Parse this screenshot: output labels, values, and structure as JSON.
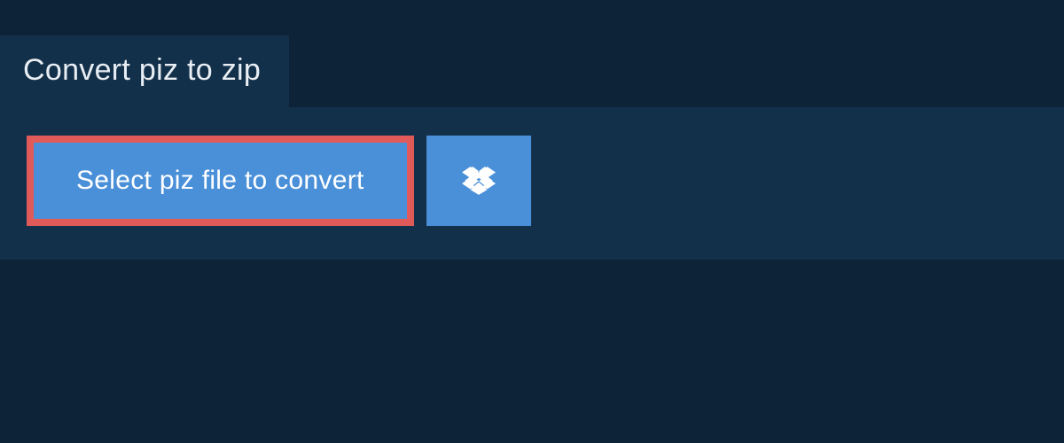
{
  "tab": {
    "title": "Convert piz to zip"
  },
  "panel": {
    "select_button_label": "Select piz file to convert"
  },
  "colors": {
    "page_bg": "#0d2438",
    "panel_bg": "#13304b",
    "button_bg": "#4a90d9",
    "highlight_border": "#e05a5a",
    "text": "#ffffff"
  },
  "icons": {
    "dropbox": "dropbox-icon"
  }
}
